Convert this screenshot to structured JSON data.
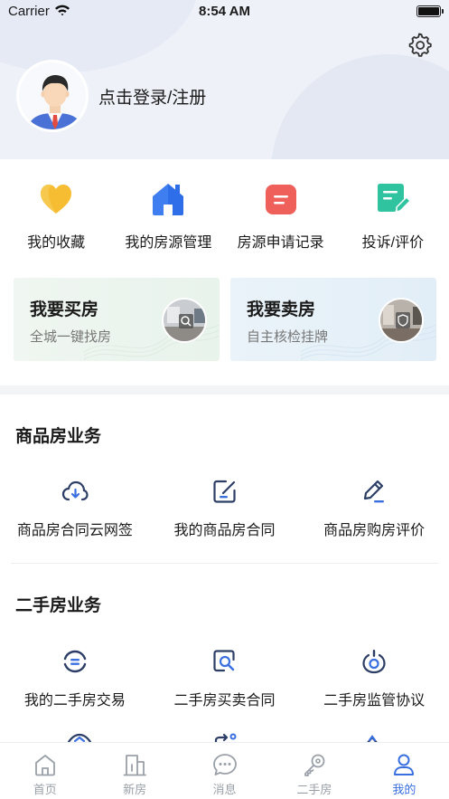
{
  "status_bar": {
    "carrier": "Carrier",
    "time": "8:54 AM"
  },
  "header": {
    "login_text": "点击登录/注册"
  },
  "quick_actions": [
    {
      "label": "我的收藏",
      "icon": "heart-icon",
      "color": "#f5b82e"
    },
    {
      "label": "我的房源管理",
      "icon": "house-icon",
      "color": "#3f7ef0"
    },
    {
      "label": "房源申请记录",
      "icon": "list-icon",
      "color": "#f0605a"
    },
    {
      "label": "投诉/评价",
      "icon": "edit-note-icon",
      "color": "#2fc3a0"
    }
  ],
  "cards": {
    "buy": {
      "title": "我要买房",
      "subtitle": "全城一键找房"
    },
    "sell": {
      "title": "我要卖房",
      "subtitle": "自主核检挂牌"
    }
  },
  "commercial": {
    "title": "商品房业务",
    "items": [
      {
        "label": "商品房合同云网签",
        "icon": "cloud-download-icon"
      },
      {
        "label": "我的商品房合同",
        "icon": "edit-square-icon"
      },
      {
        "label": "商品房购房评价",
        "icon": "pen-icon"
      }
    ]
  },
  "secondhand": {
    "title": "二手房业务",
    "items": [
      {
        "label": "我的二手房交易",
        "icon": "exchange-icon"
      },
      {
        "label": "二手房买卖合同",
        "icon": "search-doc-icon"
      },
      {
        "label": "二手房监管协议",
        "icon": "lock-ring-icon"
      }
    ]
  },
  "tabbar": [
    {
      "label": "首页",
      "icon": "home-icon",
      "active": false
    },
    {
      "label": "新房",
      "icon": "building-icon",
      "active": false
    },
    {
      "label": "消息",
      "icon": "chat-icon",
      "active": false
    },
    {
      "label": "二手房",
      "icon": "key-icon",
      "active": false
    },
    {
      "label": "我的",
      "icon": "user-icon",
      "active": true
    }
  ],
  "colors": {
    "accent": "#3a6fe0",
    "icon_dark": "#2c3e66",
    "tab_inactive": "#9aa0a8"
  }
}
